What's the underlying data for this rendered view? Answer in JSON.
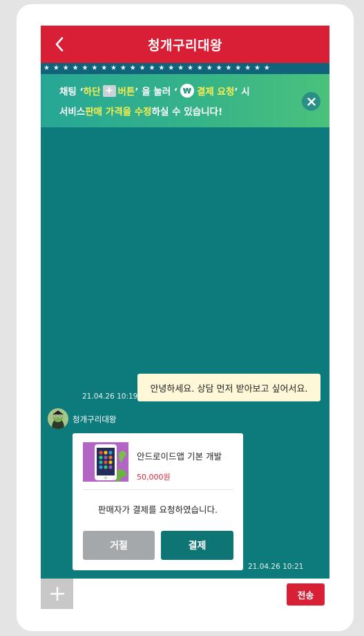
{
  "header": {
    "title": "청개구리대왕"
  },
  "stars": "★★★★★★★★★★★★★★★★★★★★★★★★",
  "notice": {
    "l1_a": "채팅 ‘ ",
    "l1_b": "하단",
    "l1_plus": "+",
    "l1_c": "버튼",
    "l1_d": " ’ 을 눌러 ‘ ",
    "l1_won": "₩",
    "l1_e": "결제 요청",
    "l1_f": " ’ 시",
    "l2_a": "서비스 ",
    "l2_b": "판매 가격을 수정",
    "l2_c": "하실 수 있습니다!"
  },
  "messages": {
    "user_text": "안녕하세요. 상담 먼저 받아보고 싶어서요.",
    "user_time": "21.04.26 10:19",
    "seller_name": "청개구리대왕",
    "seller_time": "21.04.26 10:21"
  },
  "payment": {
    "product_name": "안드로이드앱 기본 개발",
    "price": "50,000원",
    "message": "판매자가 결제를 요청하였습니다.",
    "reject_label": "거절",
    "pay_label": "결제"
  },
  "input": {
    "placeholder": "",
    "send_label": "전송"
  },
  "colors": {
    "brand_red": "#d81f35",
    "chat_bg": "#0d7b7b",
    "highlight": "#f7ee51",
    "price": "#d8243c"
  }
}
